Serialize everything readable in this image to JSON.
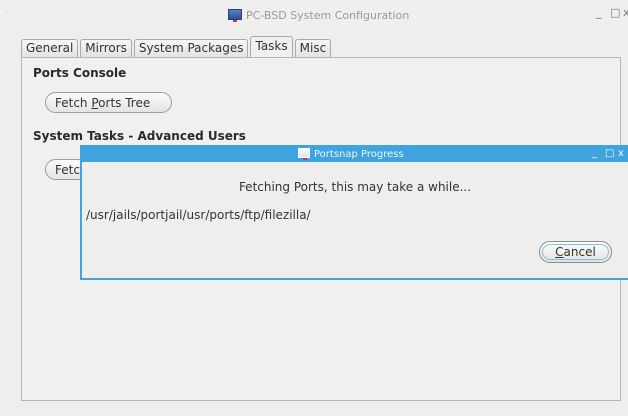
{
  "main_window": {
    "title": "PC-BSD System Configuration",
    "sys_menu_glyph": "·",
    "minimize_glyph": "_",
    "maximize_glyph": "□",
    "close_glyph": "x"
  },
  "tabs": [
    {
      "label": "General"
    },
    {
      "label": "Mirrors"
    },
    {
      "label": "System Packages"
    },
    {
      "label": "Tasks",
      "active": true
    },
    {
      "label": "Misc"
    }
  ],
  "ports_console": {
    "heading": "Ports Console",
    "fetch_button": {
      "prefix": "Fetch ",
      "mnemonic": "P",
      "suffix": "orts Tree"
    }
  },
  "system_tasks": {
    "heading": "System Tasks - Advanced Users",
    "partial_button_label": "Fetc"
  },
  "dialog": {
    "title": "Portsnap Progress",
    "minimize_glyph": "_",
    "maximize_glyph": "□",
    "close_glyph": "x",
    "message": "Fetching Ports, this may take a while...",
    "path": "/usr/jails/portjail/usr/ports/ftp/filezilla/",
    "cancel_button": {
      "mnemonic": "C",
      "suffix": "ancel"
    }
  },
  "colors": {
    "dialog_accent": "#3fa3df",
    "window_background": "#eeeeec"
  }
}
